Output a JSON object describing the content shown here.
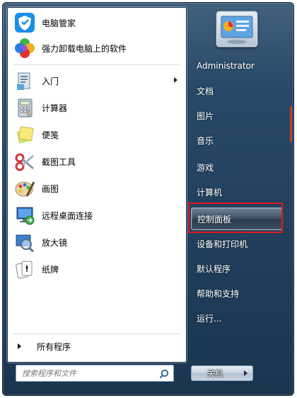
{
  "pinned": [
    {
      "label": "电脑管家",
      "icon": "tencent-shield-icon"
    },
    {
      "label": "强力卸载电脑上的软件",
      "icon": "colorful-flower-icon"
    }
  ],
  "recent": [
    {
      "label": "入门",
      "icon": "getting-started-icon",
      "has_submenu": true
    },
    {
      "label": "计算器",
      "icon": "calculator-icon"
    },
    {
      "label": "便笺",
      "icon": "sticky-notes-icon"
    },
    {
      "label": "截图工具",
      "icon": "scissors-icon"
    },
    {
      "label": "画图",
      "icon": "paint-icon"
    },
    {
      "label": "远程桌面连接",
      "icon": "remote-desktop-icon"
    },
    {
      "label": "放大镜",
      "icon": "magnifier-icon"
    },
    {
      "label": "纸牌",
      "icon": "solitaire-icon"
    }
  ],
  "all_programs": "所有程序",
  "search": {
    "placeholder": "搜索程序和文件"
  },
  "right": [
    {
      "label": "Administrator"
    },
    {
      "label": "文档"
    },
    {
      "label": "图片"
    },
    {
      "label": "音乐"
    },
    {
      "label": "游戏"
    },
    {
      "label": "计算机"
    },
    {
      "label": "控制面板",
      "highlighted": true
    },
    {
      "label": "设备和打印机"
    },
    {
      "label": "默认程序"
    },
    {
      "label": "帮助和支持"
    },
    {
      "label": "运行..."
    }
  ],
  "shutdown": {
    "label": "关机"
  },
  "colors": {
    "highlight_box": "#e11a1a",
    "frame": "#23425f"
  }
}
